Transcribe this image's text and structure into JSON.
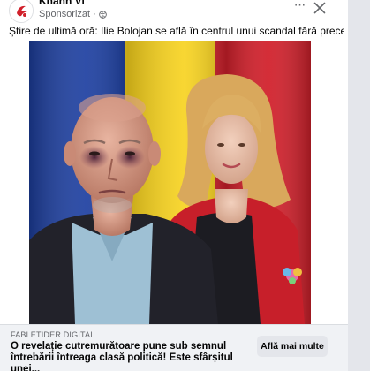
{
  "header": {
    "page_name": "Khanh Vi",
    "sponsored_label": "Sponsorizat",
    "separator": "·",
    "more_label": "···"
  },
  "post": {
    "caption": "Știre de ultimă oră: Ilie Bolojan se află în centrul unui scandal fără precedent!"
  },
  "media": {
    "flag_colors": [
      "#1d3fa0",
      "#f7d21c",
      "#d1202b"
    ]
  },
  "link": {
    "domain": "FABLETIDER.DIGITAL",
    "title": "O revelație cutremurătoare pune sub semnul întrebării întreaga clasă politică! Este sfârșitul unei...",
    "cta_label": "Află mai multe"
  },
  "icons": {
    "avatar": "page-logo-icon",
    "globe": "globe-icon",
    "more": "more-options-icon",
    "close": "close-icon"
  }
}
